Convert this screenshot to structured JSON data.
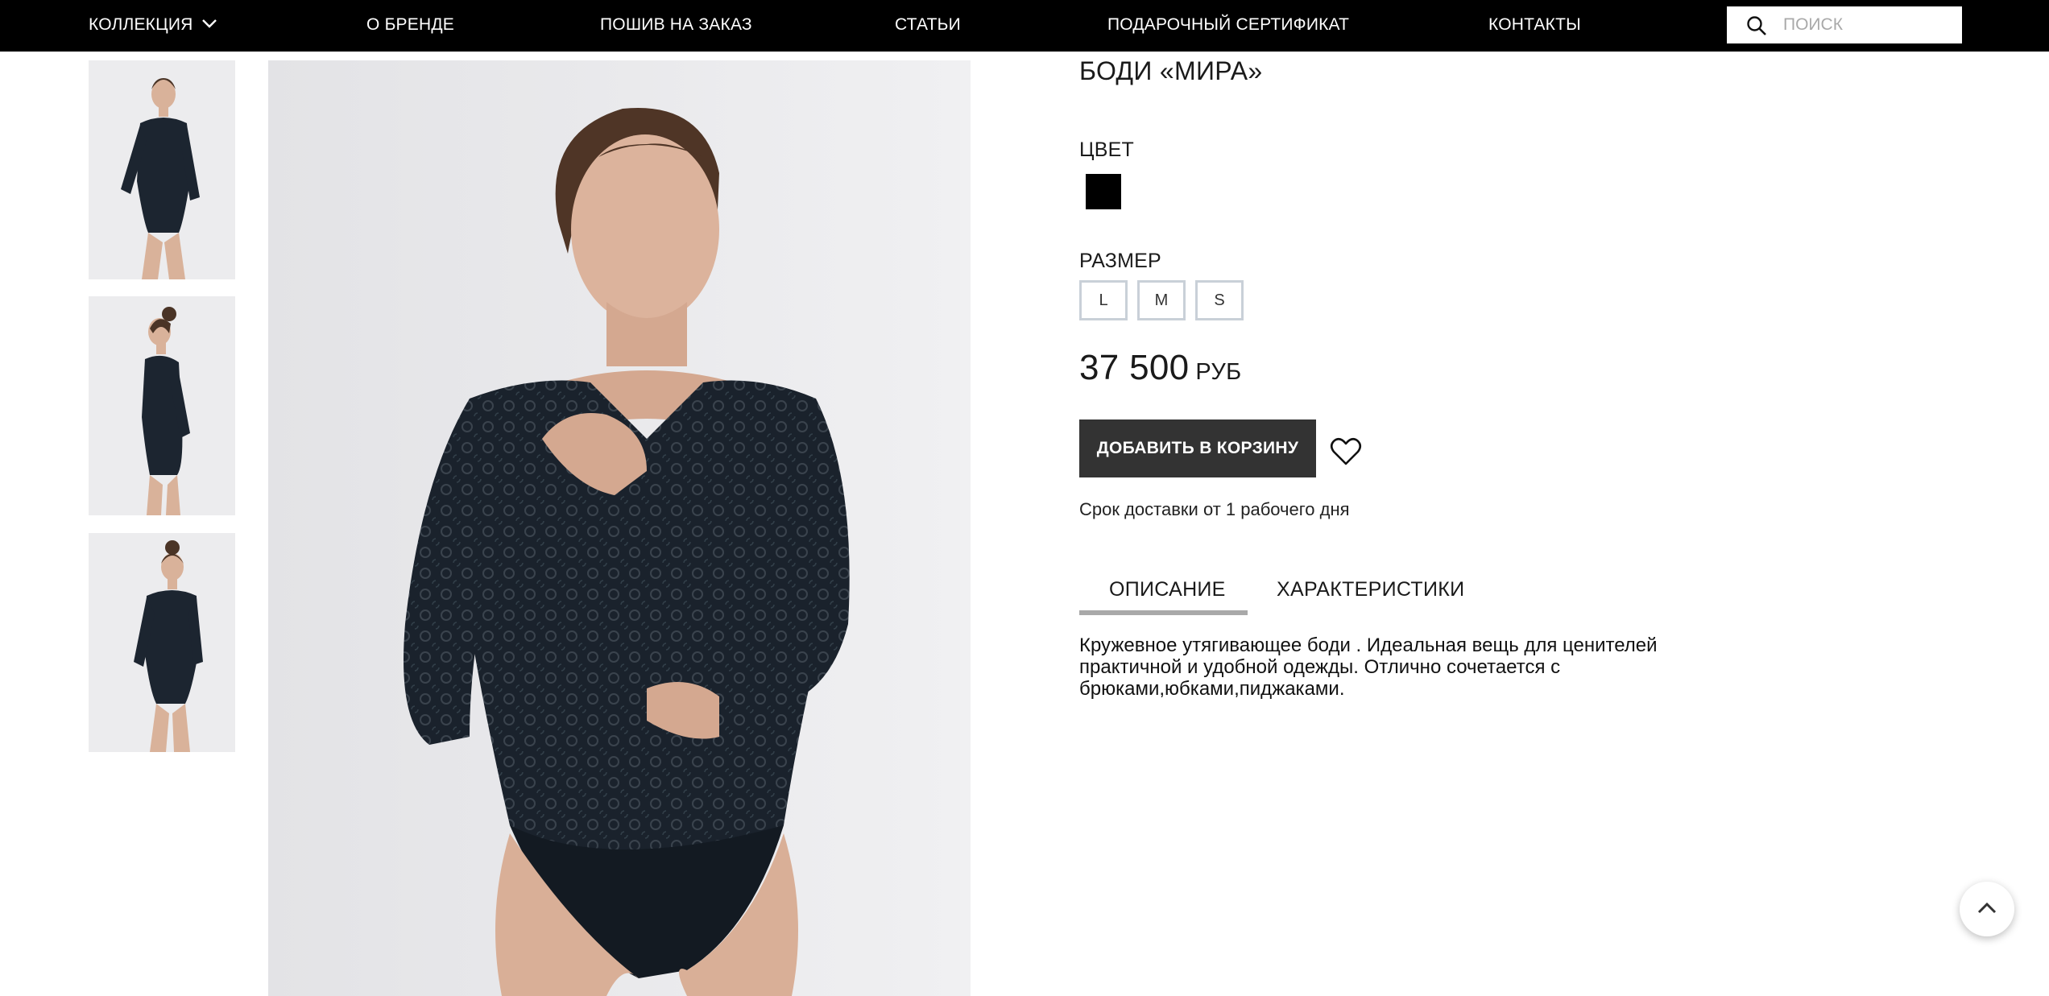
{
  "nav": {
    "collection": "КОЛЛЕКЦИЯ",
    "brand": "О БРЕНДЕ",
    "custom": "ПОШИВ НА ЗАКАЗ",
    "articles": "СТАТЬИ",
    "gift": "ПОДАРОЧНЫЙ СЕРТИФИКАТ",
    "contacts": "КОНТАКТЫ"
  },
  "search": {
    "placeholder": "ПОИСК"
  },
  "product": {
    "title": "БОДИ «МИРА»",
    "color_label": "ЦВЕТ",
    "color_value": "#000000",
    "size_label": "РАЗМЕР",
    "sizes": [
      "L",
      "M",
      "S"
    ],
    "price": "37 500",
    "currency": "РУБ",
    "add_to_cart": "ДОБАВИТЬ В КОРЗИНУ",
    "delivery": "Срок доставки от 1 рабочего дня"
  },
  "tabs": {
    "description": "ОПИСАНИЕ",
    "specs": "ХАРАКТЕРИСТИКИ",
    "active": "description"
  },
  "description_text": "Кружевное утягивающее боди . Идеальная вещь для ценителей практичной и удобной одежды. Отлично сочетается с брюками,юбками,пиджаками.",
  "icons": {
    "collection_toggle": "chevron-down-icon",
    "search": "search-icon",
    "favorite": "heart-icon",
    "scroll_top": "chevron-up-icon"
  },
  "colors": {
    "topbar": "#000000",
    "button": "#333333",
    "tab_underline": "#a9a9a9",
    "size_border": "#c9d0d8"
  }
}
